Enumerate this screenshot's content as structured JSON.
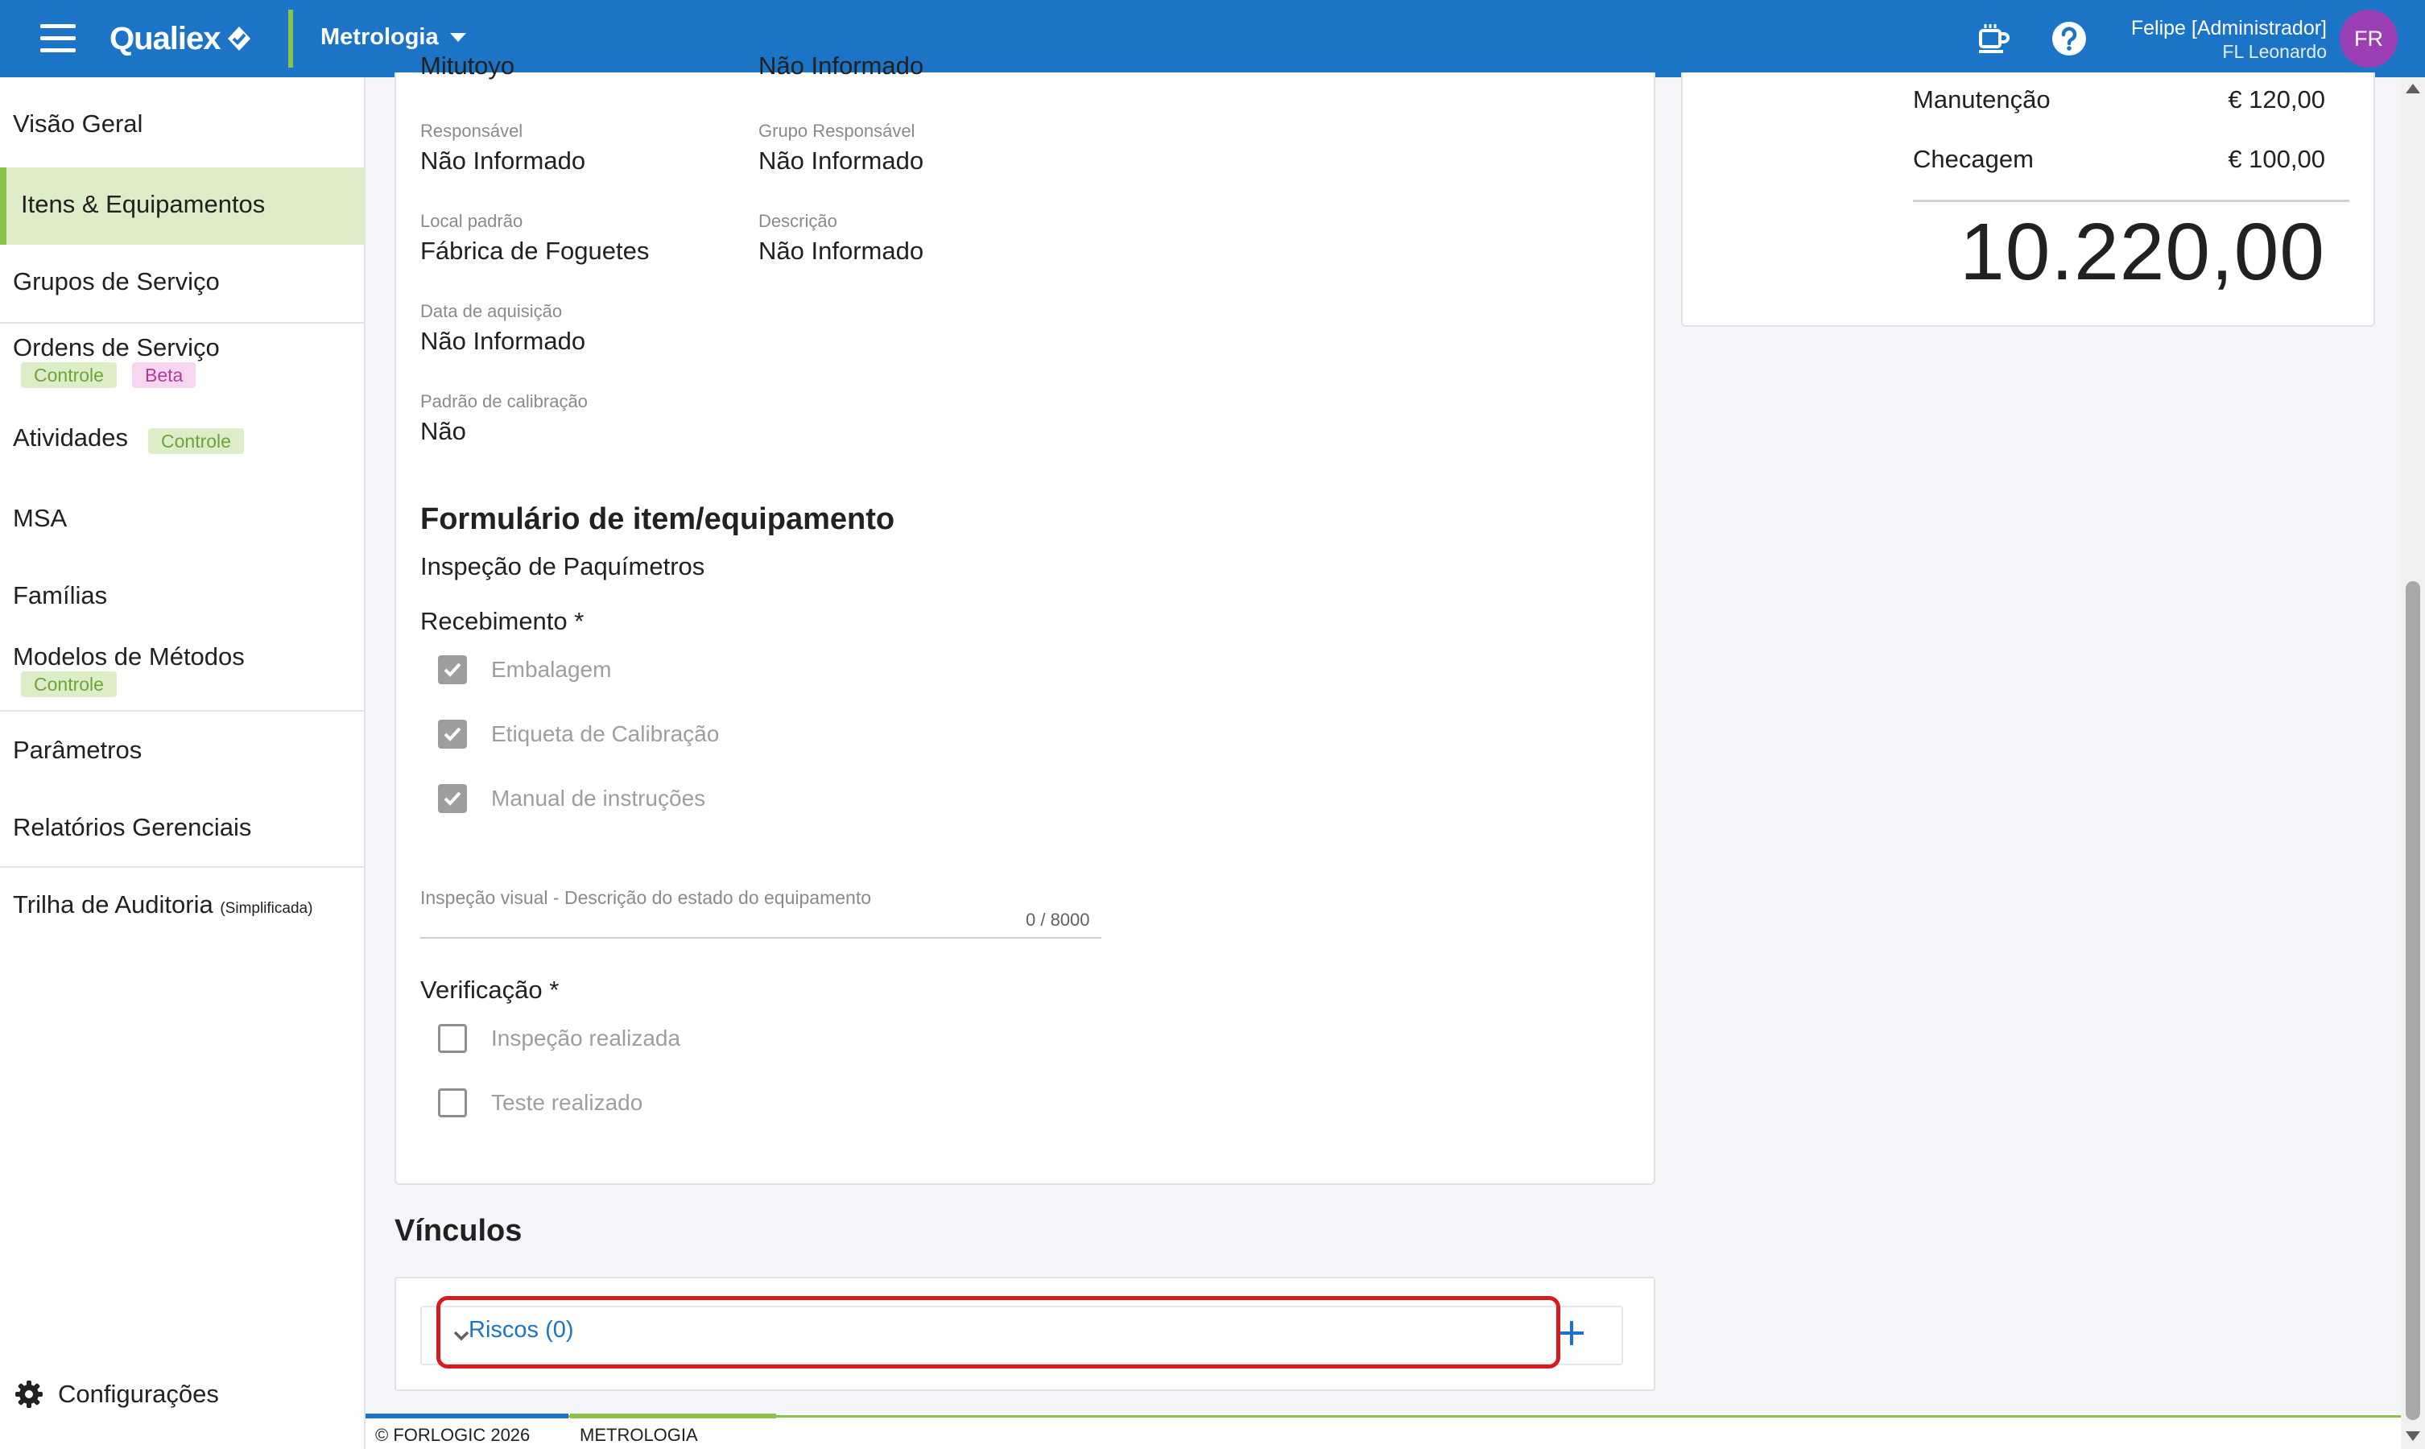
{
  "header": {
    "logo_text": "Qualiex",
    "module_label": "Metrologia",
    "user_name": "Felipe [Administrador]",
    "user_company": "FL Leonardo",
    "avatar_initials": "FR"
  },
  "sidebar": {
    "items": [
      {
        "label": "Visão Geral"
      },
      {
        "label": "Itens & Equipamentos"
      },
      {
        "label": "Grupos de Serviço"
      },
      {
        "label": "Ordens de Serviço",
        "badges": [
          "Controle",
          "Beta"
        ]
      },
      {
        "label": "Atividades",
        "badges": [
          "Controle"
        ]
      },
      {
        "label": "MSA"
      },
      {
        "label": "Famílias"
      },
      {
        "label": "Modelos de Métodos",
        "badges": [
          "Controle"
        ]
      },
      {
        "label": "Parâmetros"
      },
      {
        "label": "Relatórios Gerenciais"
      },
      {
        "label": "Trilha de Auditoria",
        "note": "(Simplificada)"
      }
    ],
    "settings_label": "Configurações"
  },
  "details": {
    "cut_top_left": "Mitutoyo",
    "cut_top_right": "Não Informado",
    "fields": [
      {
        "label": "Responsável",
        "value": "Não Informado"
      },
      {
        "label": "Grupo Responsável",
        "value": "Não Informado"
      },
      {
        "label": "Local padrão",
        "value": "Fábrica de Foguetes"
      },
      {
        "label": "Descrição",
        "value": "Não Informado"
      },
      {
        "label": "Data de aquisição",
        "value": "Não Informado"
      },
      {
        "label": "Padrão de calibração",
        "value": "Não"
      }
    ]
  },
  "form": {
    "title": "Formulário de item/equipamento",
    "subtitle": "Inspeção de Paquímetros",
    "receiving_label": "Recebimento *",
    "receiving_items": [
      {
        "label": "Embalagem",
        "checked": true
      },
      {
        "label": "Etiqueta de Calibração",
        "checked": true
      },
      {
        "label": "Manual de instruções",
        "checked": true
      }
    ],
    "textarea_label": "Inspeção visual - Descrição do estado do equipamento",
    "textarea_counter": "0 / 8000",
    "verification_label": "Verificação *",
    "verification_items": [
      {
        "label": "Inspeção realizada",
        "checked": false
      },
      {
        "label": "Teste realizado",
        "checked": false
      }
    ]
  },
  "costs": {
    "rows": [
      {
        "label": "Manutenção",
        "amount": "€ 120,00"
      },
      {
        "label": "Checagem",
        "amount": "€ 100,00"
      }
    ],
    "total": "10.220,00"
  },
  "links": {
    "title": "Vínculos",
    "risks_label": "Riscos (0)"
  },
  "footer": {
    "copyright": "© FORLOGIC 2026",
    "module": "METROLOGIA"
  },
  "colors": {
    "primary": "#1b74c5",
    "accent_green": "#8bc34a",
    "highlight_red": "#d81b1b",
    "avatar": "#9c3fb4"
  }
}
